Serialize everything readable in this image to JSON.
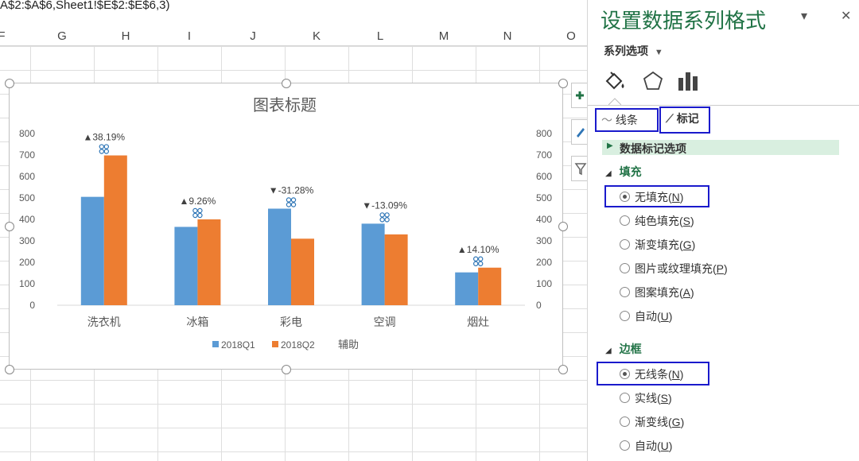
{
  "formula_bar": {
    "text": "A$2:$A$6,Sheet1!$E$2:$E$6,3)"
  },
  "columns": [
    "F",
    "G",
    "H",
    "I",
    "J",
    "K",
    "L",
    "M",
    "N",
    "O"
  ],
  "chart_data": {
    "type": "bar",
    "title": "图表标题",
    "categories": [
      "洗衣机",
      "冰箱",
      "彩电",
      "空调",
      "烟灶"
    ],
    "series": [
      {
        "name": "2018Q1",
        "values": [
          505,
          365,
          450,
          380,
          153
        ],
        "color": "#5B9BD5"
      },
      {
        "name": "2018Q2",
        "values": [
          698,
          400,
          310,
          330,
          175
        ],
        "color": "#ED7D31"
      }
    ],
    "helper_series_name": "辅助",
    "data_labels": [
      "▲38.19%",
      "▲9.26%",
      "▼-31.28%",
      "▼-13.09%",
      "▲14.10%"
    ],
    "ylim": [
      0,
      800
    ],
    "y_ticks": [
      0,
      100,
      200,
      300,
      400,
      500,
      600,
      700,
      800
    ],
    "grid": false,
    "legend_position": "bottom"
  },
  "pane": {
    "title": "设置数据系列格式",
    "dropdown_icon": "▾",
    "close_icon": "✕",
    "series_options": "系列选项",
    "tab_line": "线条",
    "tab_marker": "标记",
    "marker_options": "数据标记选项",
    "fill": {
      "heading": "填充",
      "options": [
        {
          "label": "无填充",
          "key": "N",
          "selected": true
        },
        {
          "label": "纯色填充",
          "key": "S",
          "selected": false
        },
        {
          "label": "渐变填充",
          "key": "G",
          "selected": false
        },
        {
          "label": "图片或纹理填充",
          "key": "P",
          "selected": false
        },
        {
          "label": "图案填充",
          "key": "A",
          "selected": false
        },
        {
          "label": "自动",
          "key": "U",
          "selected": false
        }
      ]
    },
    "border": {
      "heading": "边框",
      "options": [
        {
          "label": "无线条",
          "key": "N",
          "selected": true
        },
        {
          "label": "实线",
          "key": "S",
          "selected": false
        },
        {
          "label": "渐变线",
          "key": "G",
          "selected": false
        },
        {
          "label": "自动",
          "key": "U",
          "selected": false
        }
      ]
    }
  }
}
